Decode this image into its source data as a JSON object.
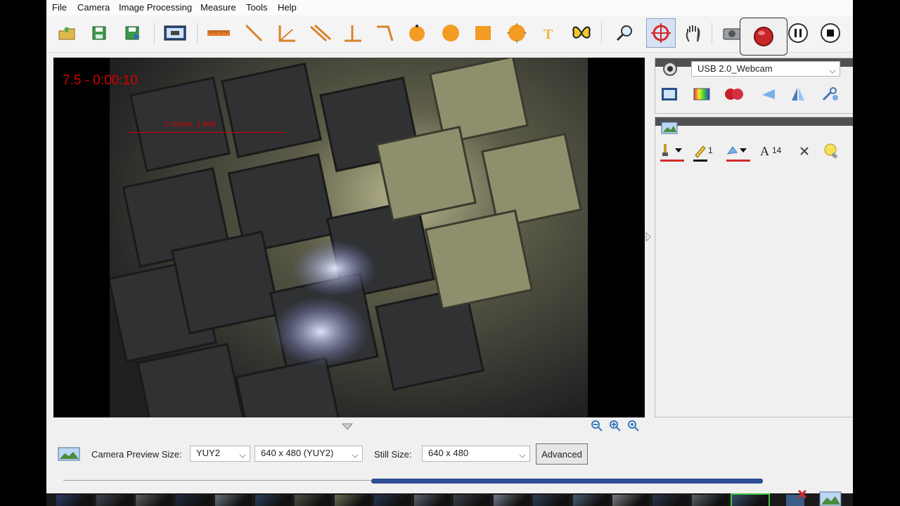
{
  "menu": [
    "File",
    "Camera",
    "Image Processing",
    "Measure",
    "Tools",
    "Help"
  ],
  "preview": {
    "overlay_time": "7.5 - 0:00:10",
    "measure_label": "2.01mm, 1.600"
  },
  "device_select": {
    "value": "USB 2.0_Webcam"
  },
  "annotation_tools": {
    "line_width": "1",
    "font_size": "14"
  },
  "bottom": {
    "camera_preview_label": "Camera Preview Size:",
    "format_value": "YUY2",
    "resolution_value": "640 x 480 (YUY2)",
    "still_label": "Still Size:",
    "still_value": "640 x 480",
    "advanced_label": "Advanced"
  },
  "progress": {
    "fraction": 0.56
  },
  "colors": {
    "overlay_red": "#d40000",
    "record_red": "#c62828",
    "panel_header": "#505050",
    "progress_blue": "#2d4d95"
  }
}
